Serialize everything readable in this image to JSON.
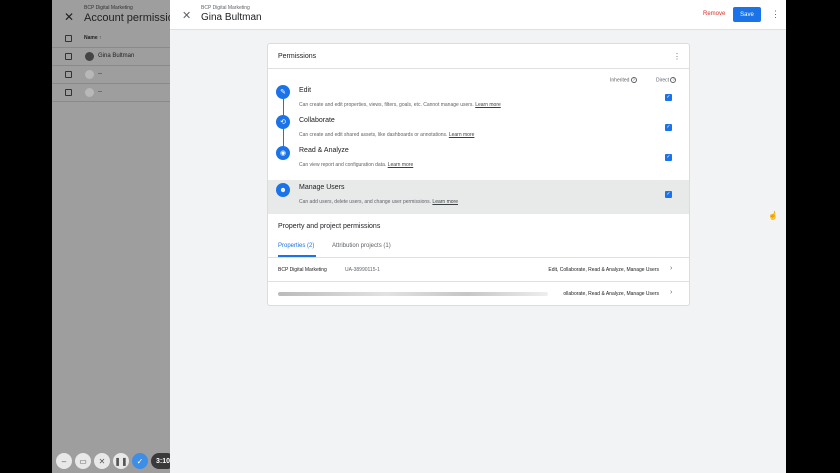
{
  "background_page": {
    "close_icon": "close-icon",
    "org": "BCP Digital Marketing",
    "title": "Account permissions",
    "name_header": "Name ↑",
    "rows": [
      {
        "name": "Gina Bultman"
      },
      {
        "name": "--"
      },
      {
        "name": "--"
      }
    ]
  },
  "recorder": {
    "time": "3:10",
    "icons": [
      "minus-icon",
      "camera-icon",
      "cancel-icon",
      "pause-icon",
      "check-icon"
    ]
  },
  "sheet": {
    "org": "BCP Digital Marketing",
    "user_name": "Gina Bultman",
    "remove_label": "Remove",
    "save_label": "Save",
    "colors": {
      "accent": "#1a73e8",
      "remove": "#d93025"
    }
  },
  "permissions": {
    "title": "Permissions",
    "col_inherited": "Inherited",
    "col_direct": "Direct",
    "items": [
      {
        "title": "Edit",
        "desc": "Can create and edit properties, views, filters, goals, etc. Cannot manage users.",
        "link": "Learn more",
        "direct": true,
        "icon": "pencil-icon"
      },
      {
        "title": "Collaborate",
        "desc": "Can create and edit shared assets, like dashboards or annotations.",
        "link": "Learn more",
        "direct": true,
        "icon": "share-icon"
      },
      {
        "title": "Read & Analyze",
        "desc": "Can view report and configuration data.",
        "link": "Learn more",
        "direct": true,
        "icon": "eye-icon"
      },
      {
        "title": "Manage Users",
        "desc": "Can add users, delete users, and change user permissions.",
        "link": "Learn more",
        "direct": true,
        "icon": "users-icon"
      }
    ]
  },
  "projects": {
    "title": "Property and project permissions",
    "tabs": [
      {
        "label": "Properties (2)",
        "active": true
      },
      {
        "label": "Attribution projects (1)",
        "active": false
      }
    ],
    "rows": [
      {
        "name": "BCP Digital Marketing",
        "id": "UA-38990115-1",
        "roles": "Edit, Collaborate, Read & Analyze, Manage Users"
      },
      {
        "name": "",
        "id": "",
        "roles": "ollaborate, Read & Analyze, Manage Users"
      }
    ]
  }
}
